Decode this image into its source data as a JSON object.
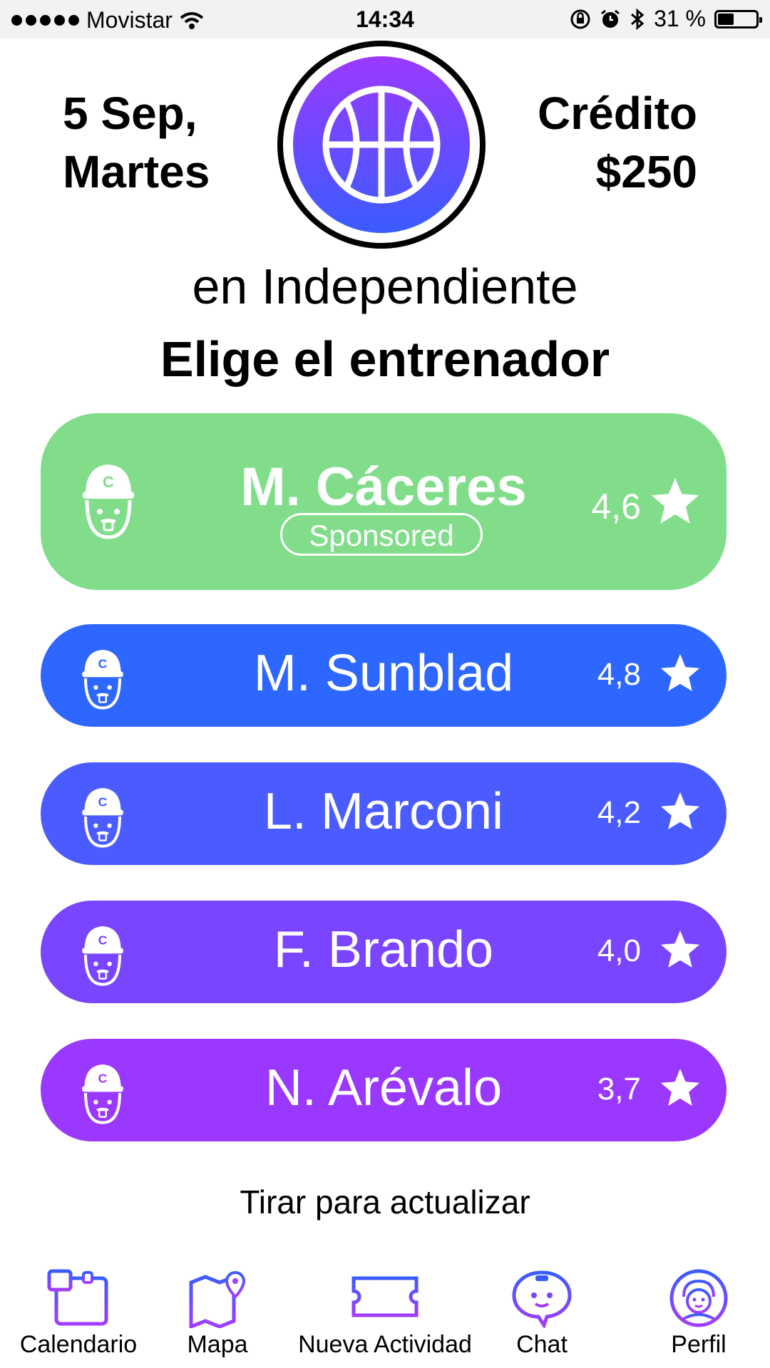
{
  "status_bar": {
    "carrier": "Movistar",
    "time": "14:34",
    "battery": "31 %"
  },
  "header": {
    "date_line1": "5 Sep,",
    "date_line2": "Martes",
    "credit_label": "Crédito",
    "credit_value": "$250",
    "venue": "en Independiente",
    "prompt": "Elige el entrenador"
  },
  "coaches": [
    {
      "name": "M. Cáceres",
      "rating": "4,6",
      "badge": "Sponsored",
      "color": "#82dd8b"
    },
    {
      "name": "M. Sunblad",
      "rating": "4,8",
      "color": "#2d67ff"
    },
    {
      "name": "L. Marconi",
      "rating": "4,2",
      "color": "#4a5cff"
    },
    {
      "name": "F. Brando",
      "rating": "4,0",
      "color": "#7a45ff"
    },
    {
      "name": "N. Arévalo",
      "rating": "3,7",
      "color": "#9a38ff"
    }
  ],
  "pull_to_refresh": "Tirar para actualizar",
  "tabs": [
    {
      "label": "Calendario",
      "icon": "calendar-icon"
    },
    {
      "label": "Mapa",
      "icon": "map-icon"
    },
    {
      "label": "Nueva Actividad",
      "icon": "ticket-icon"
    },
    {
      "label": "Chat",
      "icon": "chat-bubble-icon"
    },
    {
      "label": "Perfil",
      "icon": "profile-icon"
    }
  ]
}
